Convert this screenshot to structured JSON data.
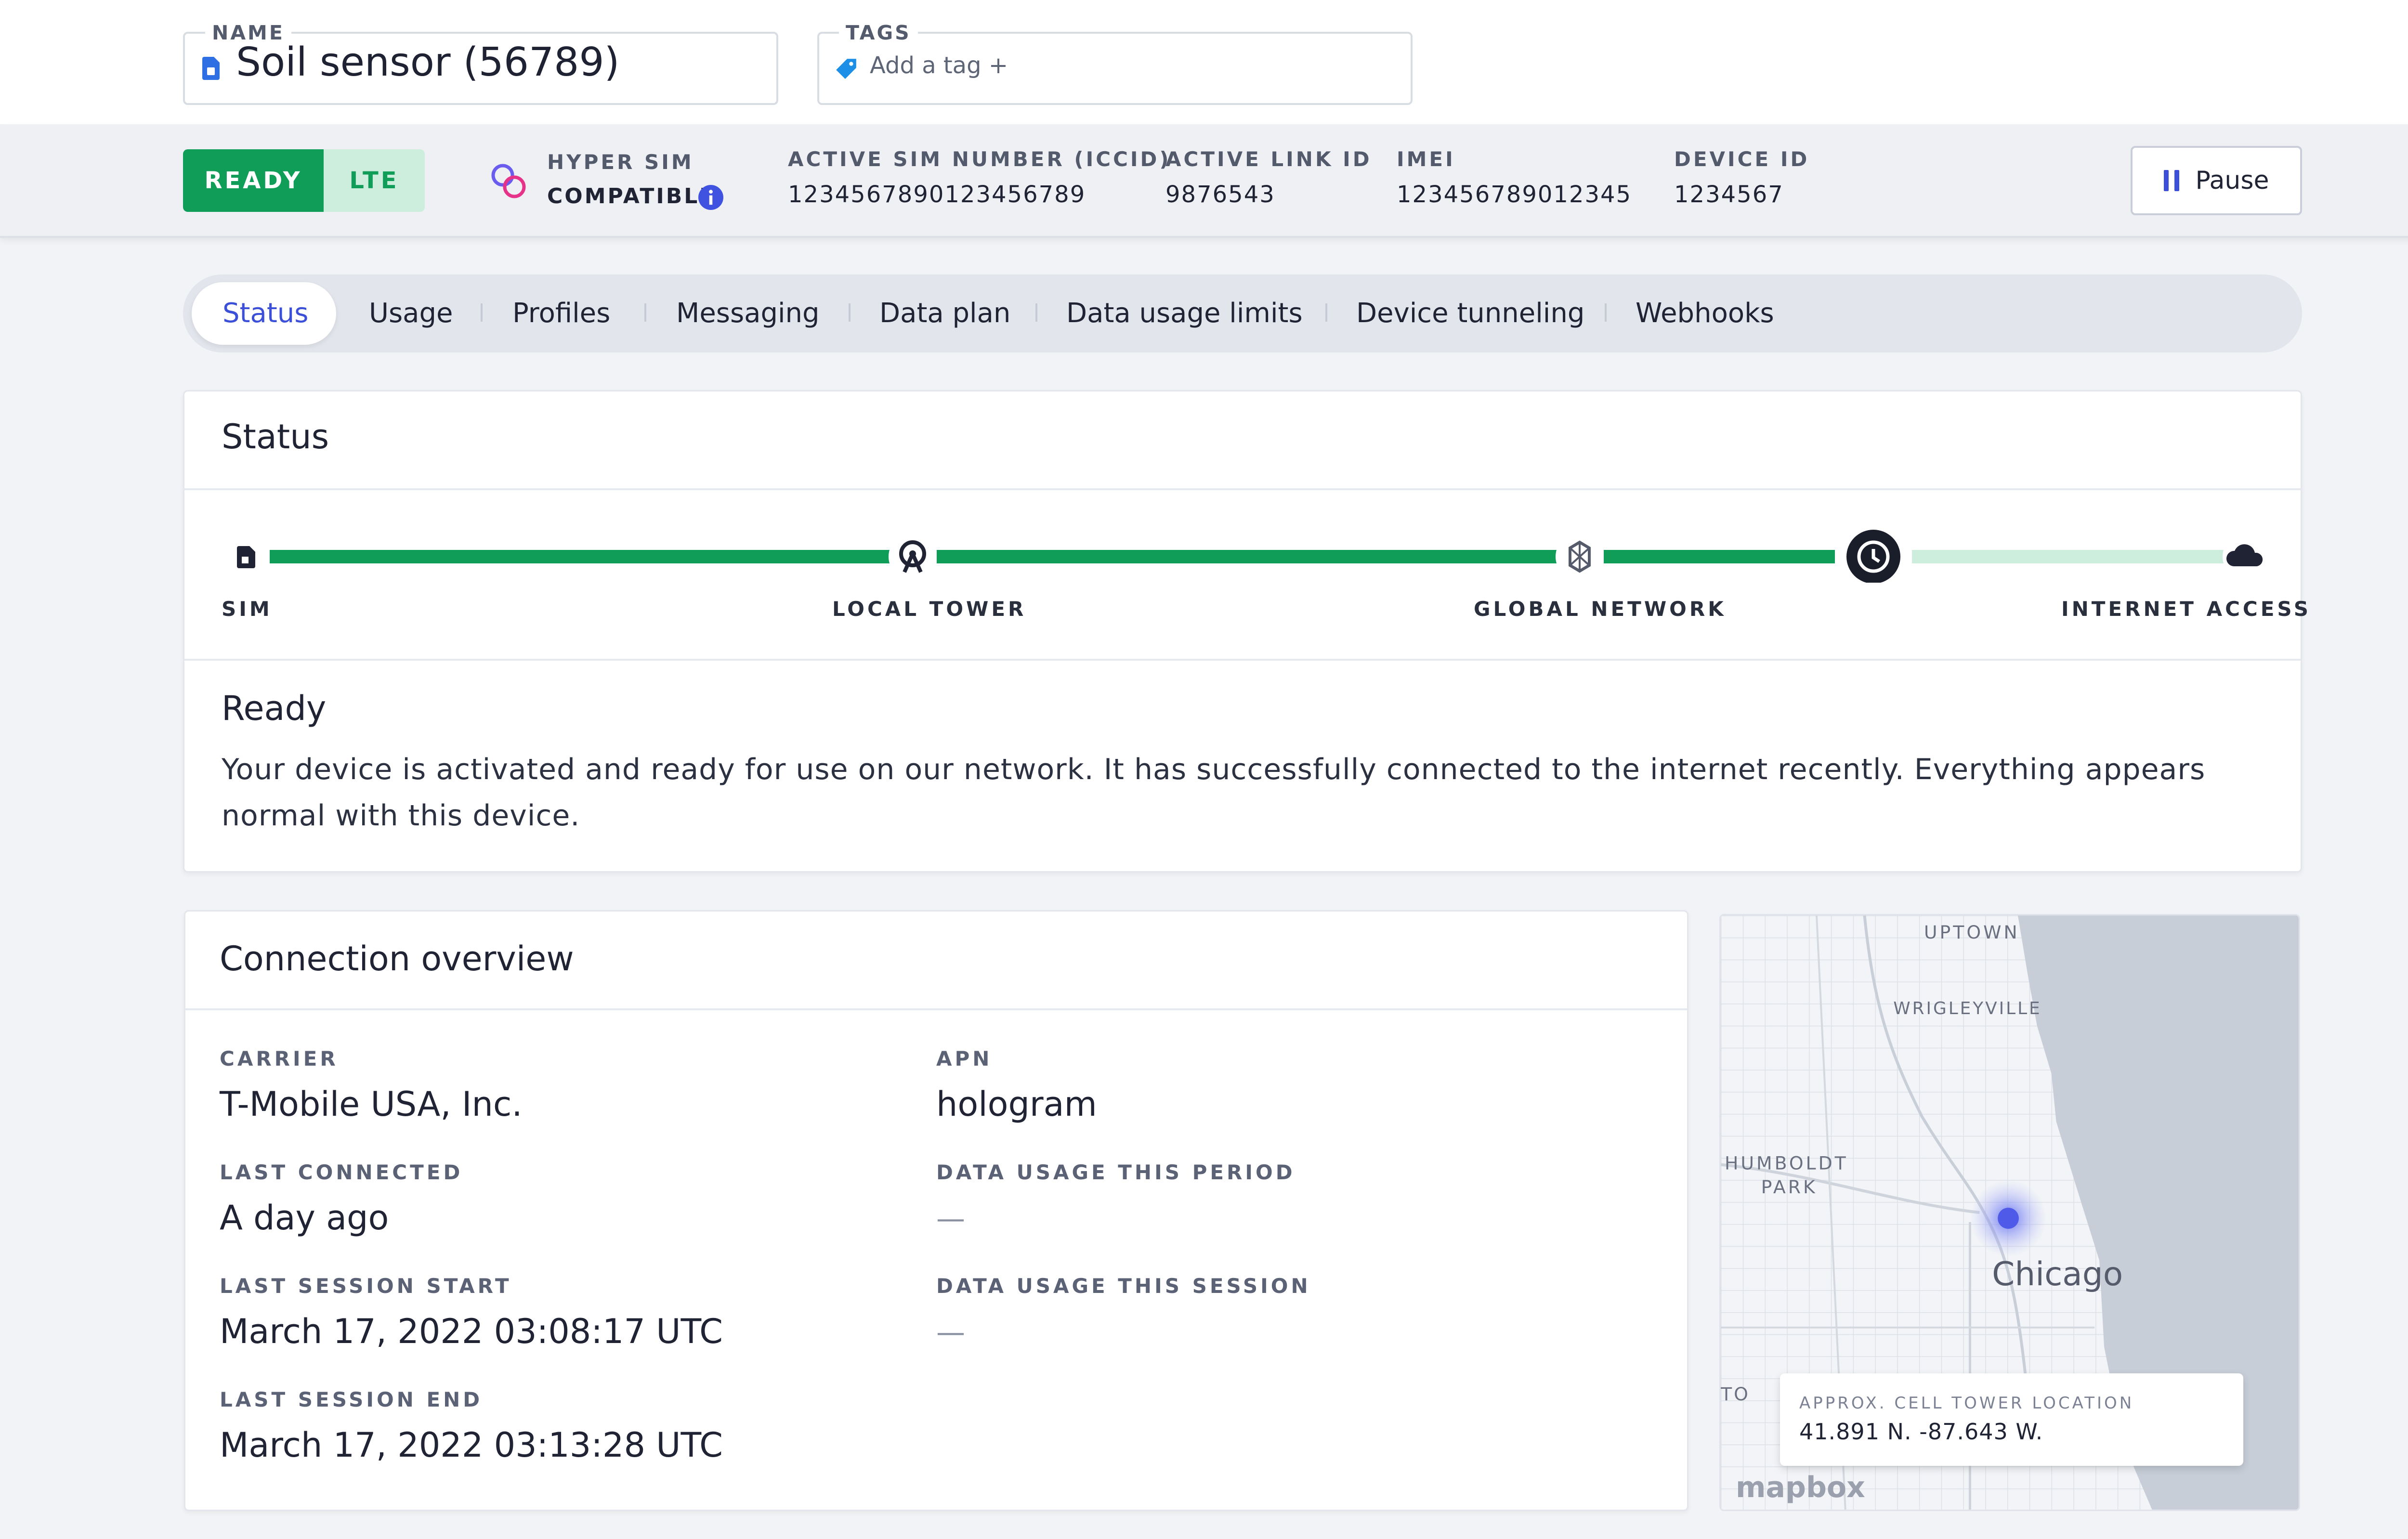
{
  "header": {
    "name_label": "NAME",
    "name_value": "Soil sensor (56789)",
    "tags_label": "TAGS",
    "tags_placeholder": "Add a tag +"
  },
  "info": {
    "status": "READY",
    "network_type": "LTE",
    "hyper_sim_label": "HYPER SIM",
    "hyper_sim_value": "COMPATIBLE",
    "iccid_label": "ACTIVE SIM NUMBER (ICCID)",
    "iccid_value": "1234567890123456789",
    "link_label": "ACTIVE LINK ID",
    "link_value": "9876543",
    "imei_label": "IMEI",
    "imei_value": "123456789012345",
    "device_label": "DEVICE ID",
    "device_value": "1234567",
    "pause_label": "Pause"
  },
  "tabs": [
    {
      "label": "Status",
      "active": true
    },
    {
      "label": "Usage"
    },
    {
      "label": "Profiles"
    },
    {
      "label": "Messaging"
    },
    {
      "label": "Data plan"
    },
    {
      "label": "Data usage limits"
    },
    {
      "label": "Device tunneling"
    },
    {
      "label": "Webhooks"
    }
  ],
  "status": {
    "title": "Status",
    "steps": [
      "SIM",
      "LOCAL TOWER",
      "GLOBAL NETWORK",
      "INTERNET ACCESS"
    ],
    "state_title": "Ready",
    "state_description": "Your device is activated and ready for use on our network. It has successfully connected to the internet recently. Everything appears normal with this device."
  },
  "connection": {
    "title": "Connection overview",
    "carrier_label": "CARRIER",
    "carrier_value": "T-Mobile USA, Inc.",
    "apn_label": "APN",
    "apn_value": "hologram",
    "last_connected_label": "LAST CONNECTED",
    "last_connected_value": "A day ago",
    "usage_period_label": "DATA USAGE THIS PERIOD",
    "usage_period_value": "—",
    "session_start_label": "LAST SESSION START",
    "session_start_value": "March 17, 2022 03:08:17 UTC",
    "usage_session_label": "DATA USAGE THIS SESSION",
    "usage_session_value": "—",
    "session_end_label": "LAST SESSION END",
    "session_end_value": "March 17, 2022 03:13:28 UTC"
  },
  "map": {
    "labels": [
      "UPTOWN",
      "WRIGLEYVILLE",
      "HUMBOLDT",
      "PARK",
      "Chicago",
      "TO"
    ],
    "tooltip_label": "APPROX. CELL TOWER LOCATION",
    "tooltip_value": "41.891 N. -87.643 W.",
    "attribution": "mapbox"
  },
  "colors": {
    "ready_green": "#0f9d58",
    "accent_blue": "#3b4fd8",
    "water": "#c7ced8"
  }
}
